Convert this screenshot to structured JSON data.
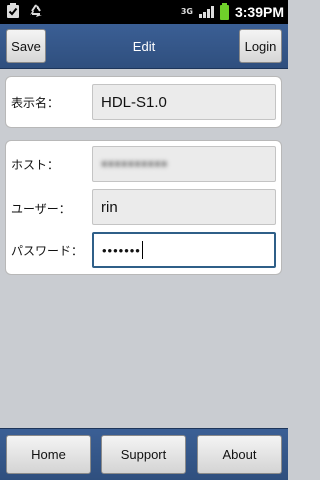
{
  "status_bar": {
    "network": "3G",
    "time": "3:39PM",
    "left_icons": [
      "clipboard-check-icon",
      "recycle-icon"
    ],
    "battery_color": "#6fd02a"
  },
  "title_bar": {
    "title": "Edit",
    "save_label": "Save",
    "login_label": "Login"
  },
  "form": {
    "display_name_label": "表示名：",
    "display_name_value": "HDL-S1.0",
    "host_label": "ホスト：",
    "host_value": "●●●●●●●●●●",
    "user_label": "ユーザー：",
    "user_value": "rin",
    "password_label": "パスワード：",
    "password_value": "•••••••"
  },
  "bottom_bar": {
    "home_label": "Home",
    "support_label": "Support",
    "about_label": "About"
  },
  "colors": {
    "bar_blue": "#34588a",
    "background": "#c9ccd1",
    "focus_border": "#2f5f88"
  }
}
